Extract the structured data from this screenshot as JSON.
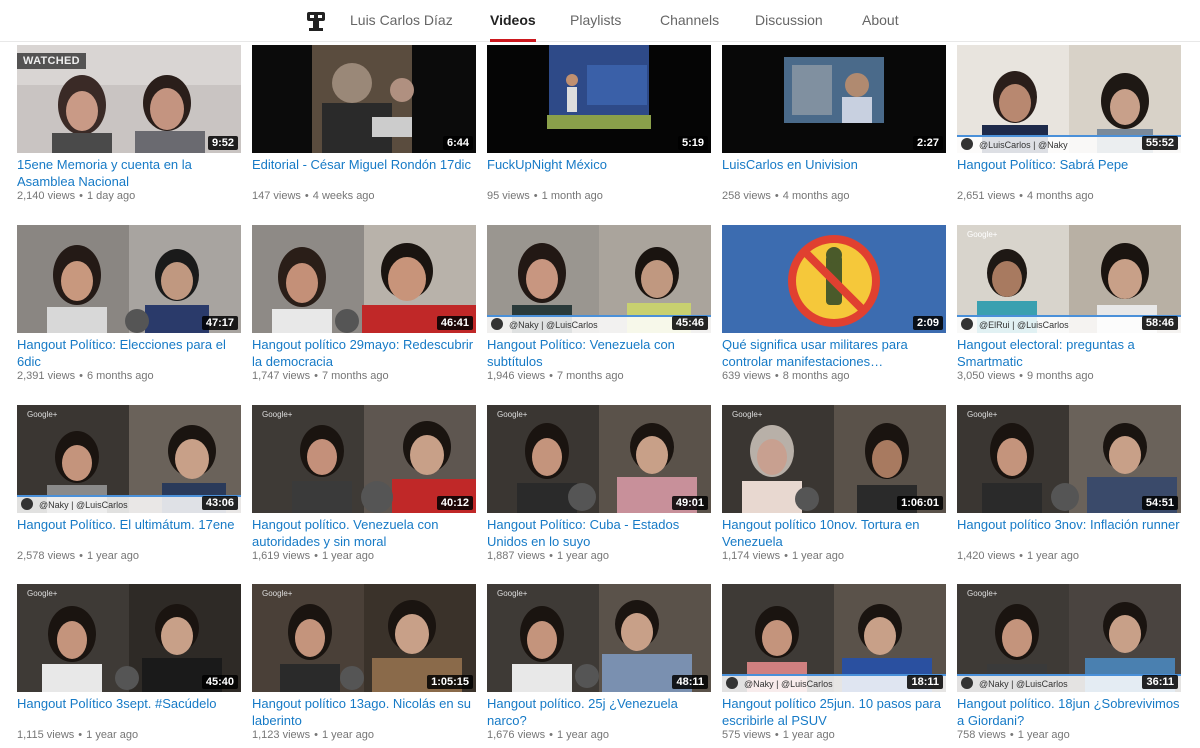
{
  "header": {
    "channel_name": "Luis Carlos Díaz",
    "tabs": [
      {
        "label": "Videos",
        "active": true
      },
      {
        "label": "Playlists",
        "active": false
      },
      {
        "label": "Channels",
        "active": false
      },
      {
        "label": "Discussion",
        "active": false
      },
      {
        "label": "About",
        "active": false
      }
    ],
    "accent_color": "#cc181e"
  },
  "videos": [
    {
      "title": "15ene Memoria y cuenta en la Asamblea Nacional",
      "views": "2,140 views",
      "age": "1 day ago",
      "duration": "9:52",
      "watched": "WATCHED"
    },
    {
      "title": "Editorial - César Miguel Rondón 17dic",
      "views": "147 views",
      "age": "4 weeks ago",
      "duration": "6:44"
    },
    {
      "title": "FuckUpNight México",
      "views": "95 views",
      "age": "1 month ago",
      "duration": "5:19"
    },
    {
      "title": "LuisCarlos en Univision",
      "views": "258 views",
      "age": "4 months ago",
      "duration": "2:27"
    },
    {
      "title": "Hangout Político: Sabrá Pepe",
      "views": "2,651 views",
      "age": "4 months ago",
      "duration": "55:52"
    },
    {
      "title": "Hangout Político: Elecciones para el 6dic",
      "views": "2,391 views",
      "age": "6 months ago",
      "duration": "47:17"
    },
    {
      "title": "Hangout político 29mayo: Redescubrir la democracia",
      "views": "1,747 views",
      "age": "7 months ago",
      "duration": "46:41"
    },
    {
      "title": "Hangout Político: Venezuela con subtítulos",
      "views": "1,946 views",
      "age": "7 months ago",
      "duration": "45:46"
    },
    {
      "title": "Qué significa usar militares para controlar manifestaciones…",
      "views": "639 views",
      "age": "8 months ago",
      "duration": "2:09"
    },
    {
      "title": "Hangout electoral: preguntas a Smartmatic",
      "views": "3,050 views",
      "age": "9 months ago",
      "duration": "58:46"
    },
    {
      "title": "Hangout Político. El ultimátum. 17ene",
      "views": "2,578 views",
      "age": "1 year ago",
      "duration": "43:06"
    },
    {
      "title": "Hangout político. Venezuela con autoridades y sin moral",
      "views": "1,619 views",
      "age": "1 year ago",
      "duration": "40:12"
    },
    {
      "title": "Hangout Político: Cuba - Estados Unidos en lo suyo",
      "views": "1,887 views",
      "age": "1 year ago",
      "duration": "49:01"
    },
    {
      "title": "Hangout político 10nov. Tortura en Venezuela",
      "views": "1,174 views",
      "age": "1 year ago",
      "duration": "1:06:01"
    },
    {
      "title": "Hangout político 3nov: Inflación runner",
      "views": "1,420 views",
      "age": "1 year ago",
      "duration": "54:51"
    },
    {
      "title": "Hangout Político 3sept. #Sacúdelo",
      "views": "1,115 views",
      "age": "1 year ago",
      "duration": "45:40"
    },
    {
      "title": "Hangout político 13ago. Nicolás en su laberinto",
      "views": "1,123 views",
      "age": "1 year ago",
      "duration": "1:05:15"
    },
    {
      "title": "Hangout político. 25j ¿Venezuela narco?",
      "views": "1,676 views",
      "age": "1 year ago",
      "duration": "48:11"
    },
    {
      "title": "Hangout político 25jun. 10 pasos para escribirle al PSUV",
      "views": "575 views",
      "age": "1 year ago",
      "duration": "18:11"
    },
    {
      "title": "Hangout político. 18jun ¿Sobrevivimos a Giordani?",
      "views": "758 views",
      "age": "1 year ago",
      "duration": "36:11"
    }
  ],
  "overlay_texts": {
    "v4": "@LuisCarlos | @Naky",
    "v7": "@Naky | @LuisCarlos",
    "v9": "@ElRui | @LuisCarlos",
    "v10": "@Naky | @LuisCarlos",
    "v18": "@Naky | @LuisCarlos",
    "v19": "@Naky | @LuisCarlos",
    "google_plus": "Google+"
  }
}
